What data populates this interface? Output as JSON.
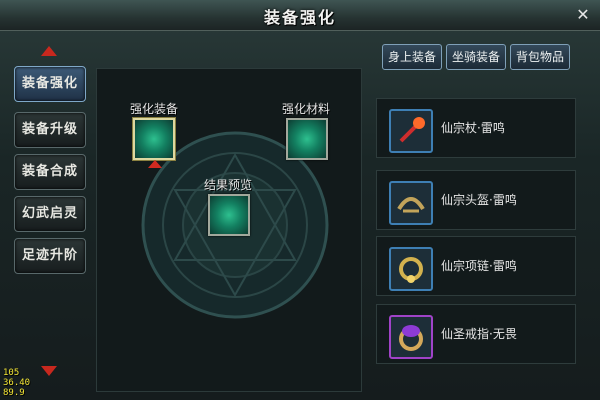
{
  "window": {
    "title": "装备强化"
  },
  "left_tabs": [
    "装备强化",
    "装备升级",
    "装备合成",
    "幻武启灵",
    "足迹升阶"
  ],
  "center": {
    "enhance_equip_label": "强化装备",
    "enhance_material_label": "强化材料",
    "preview_label": "结果预览"
  },
  "top_buttons": [
    "身上装备",
    "坐骑装备",
    "背包物品"
  ],
  "items": [
    {
      "name": "仙宗杖·雷鸣",
      "icon": "staff-icon"
    },
    {
      "name": "仙宗头盔·雷鸣",
      "icon": "helmet-icon"
    },
    {
      "name": "仙宗项链·雷鸣",
      "icon": "necklace-icon"
    },
    {
      "name": "仙圣戒指·无畏",
      "icon": "ring-icon"
    }
  ],
  "fps": [
    "105",
    "36.40",
    "89.9"
  ]
}
